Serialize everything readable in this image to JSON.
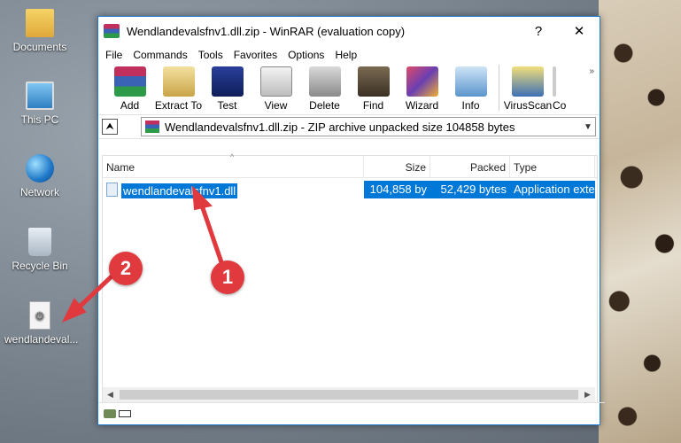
{
  "desktop": {
    "icons": [
      {
        "label": "Documents",
        "icon": "documents-folder-icon"
      },
      {
        "label": "This PC",
        "icon": "this-pc-icon"
      },
      {
        "label": "Network",
        "icon": "network-icon"
      },
      {
        "label": "Recycle Bin",
        "icon": "recycle-bin-icon"
      },
      {
        "label": "wendlandeval...",
        "icon": "dll-file-icon"
      }
    ]
  },
  "window": {
    "title": "Wendlandevalsfnv1.dll.zip - WinRAR (evaluation copy)",
    "help_btn": "?",
    "close_btn": "✕",
    "menu": [
      "File",
      "Commands",
      "Tools",
      "Favorites",
      "Options",
      "Help"
    ],
    "toolbar": [
      "Add",
      "Extract To",
      "Test",
      "View",
      "Delete",
      "Find",
      "Wizard",
      "Info",
      "VirusScan",
      "Co"
    ],
    "toolbar_more": "»",
    "address": "Wendlandevalsfnv1.dll.zip - ZIP archive unpacked size 104858 bytes",
    "up_btn": "⮝",
    "columns": [
      "Name",
      "Size",
      "Packed",
      "Type"
    ],
    "rows": [
      {
        "name": "wendlandevalsfnv1.dll",
        "size": "104,858 by",
        "packed": "52,429 bytes",
        "type": "Application exte",
        "selected": true
      }
    ]
  },
  "annotations": {
    "badge1": "1",
    "badge2": "2",
    "color": "#e0393e"
  }
}
